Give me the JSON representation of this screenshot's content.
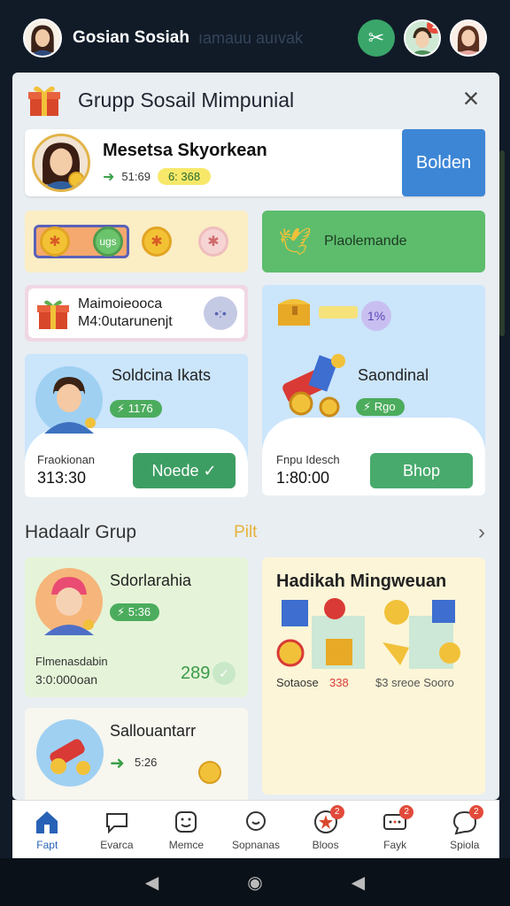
{
  "topbar": {
    "title": "Gosian Sosiah",
    "faded_text": "ıamauu auıvak",
    "badge": "2"
  },
  "panel": {
    "title": "Grupp Sosail Mimpunial"
  },
  "profile": {
    "name": "Mesetsa Skyorkean",
    "stat": "51:69",
    "pill": "6: 368",
    "button": "Bolden"
  },
  "row2": {
    "coin_green_text": "ugs",
    "right_label": "Plaolemande"
  },
  "row3_left": {
    "line1": "Maimoieooca",
    "line2": "M4:0utarunenjt"
  },
  "card_left": {
    "title": "Soldcina Ikats",
    "pill": "1176",
    "small_label": "Fraokionan",
    "number": "313:30",
    "button": "Noede ✓"
  },
  "card_right": {
    "title": "Saondinal",
    "small_pill": "1%",
    "pill": "Rgo",
    "small_label": "Fnpu Idesch",
    "number": "1:80:00",
    "button": "Bhop"
  },
  "section": {
    "title": "Hadaalr Grup",
    "link": "Pilt"
  },
  "bot_left1": {
    "title": "Sdorlarahia",
    "pill": "5:36",
    "small_label": "Flmenasdabin",
    "number": "3:0:000oan",
    "score": "289"
  },
  "bot_right1": {
    "title": "Hadikah Mingweuan",
    "left_text": "Sotaose",
    "left_num": "338",
    "right_text": "$3 sreoe Sooro"
  },
  "bot_left2": {
    "title": "Sallouantarr",
    "pill": "5:26"
  },
  "tabs": [
    {
      "label": "Fapt",
      "icon": "home-icon",
      "active": true
    },
    {
      "label": "Evarca",
      "icon": "chat-icon"
    },
    {
      "label": "Memce",
      "icon": "emoji-icon"
    },
    {
      "label": "Sopnanas",
      "icon": "search-icon"
    },
    {
      "label": "Bloos",
      "icon": "star-icon",
      "badge": "2"
    },
    {
      "label": "Fayk",
      "icon": "message-icon",
      "badge": "2"
    },
    {
      "label": "Spiola",
      "icon": "bubble-icon",
      "badge": "2"
    }
  ]
}
